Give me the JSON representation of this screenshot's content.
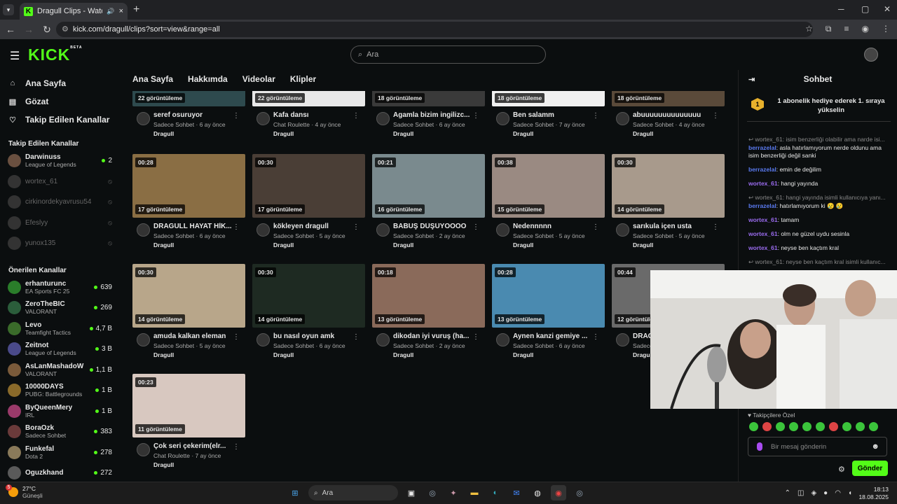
{
  "browser": {
    "tab_title": "Dragull Clips - Watch Live o",
    "url": "kick.com/dragull/clips?sort=view&range=all",
    "new_tab": "+",
    "tab_icon_letter": "K"
  },
  "header": {
    "logo": "KICK",
    "beta": "BETA",
    "search_placeholder": "Ara"
  },
  "sidebar": {
    "nav": [
      {
        "label": "Ana Sayfa",
        "icon": "home-icon"
      },
      {
        "label": "Gözat",
        "icon": "browse-icon"
      },
      {
        "label": "Takip Edilen Kanallar",
        "icon": "heart-icon"
      }
    ],
    "followed_title": "Takip Edilen Kanallar",
    "followed": [
      {
        "name": "Darwinuss",
        "game": "League of Legends",
        "count": "2",
        "live": true
      },
      {
        "name": "wortex_61",
        "live": false
      },
      {
        "name": "cirkinordekyavrusu54",
        "live": false
      },
      {
        "name": "Efeslyy",
        "live": false
      },
      {
        "name": "yunox135",
        "live": false
      }
    ],
    "recommended_title": "Önerilen Kanallar",
    "recommended": [
      {
        "name": "erhanturunc",
        "game": "EA Sports FC 25",
        "count": "639",
        "color": "#2a7d2a"
      },
      {
        "name": "ZeroTheBIC",
        "game": "VALORANT",
        "count": "269",
        "color": "#2b5d3b"
      },
      {
        "name": "Levo",
        "game": "Teamfight Tactics",
        "count": "4,7 B",
        "color": "#3a6b2a"
      },
      {
        "name": "Zeitnot",
        "game": "League of Legends",
        "count": "3 B",
        "color": "#4a4a8a"
      },
      {
        "name": "AsLanMashadoW",
        "game": "VALORANT",
        "count": "1,1 B",
        "color": "#7a5a3a"
      },
      {
        "name": "10000DAYS",
        "game": "PUBG: Battlegrounds",
        "count": "1 B",
        "color": "#8a6a2a"
      },
      {
        "name": "ByQueenMery",
        "game": "IRL",
        "count": "1 B",
        "color": "#9a3a6a"
      },
      {
        "name": "BoraOzk",
        "game": "Sadece Sohbet",
        "count": "383",
        "color": "#6a3a3a"
      },
      {
        "name": "Funkefal",
        "game": "Dota 2",
        "count": "278",
        "color": "#8a7a5a"
      },
      {
        "name": "Oguzkhand",
        "game": "",
        "count": "272",
        "color": "#5a5a5a"
      }
    ]
  },
  "main": {
    "tabs": [
      "Ana Sayfa",
      "Hakkımda",
      "Videolar",
      "Klipler"
    ],
    "clips": [
      {
        "title": "seref osuruyor",
        "category": "Sadece Sohbet",
        "age": "6 ay önce",
        "channel": "Dragull",
        "views": "22 görüntüleme",
        "duration": "",
        "bg": "#2e4a4e"
      },
      {
        "title": "Kafa dansı",
        "category": "Chat Roulette",
        "age": "4 ay önce",
        "channel": "Dragull",
        "views": "22 görüntüleme",
        "duration": "",
        "bg": "#e8e8e8"
      },
      {
        "title": "Agamla bizim ingilizc...",
        "category": "Sadece Sohbet",
        "age": "6 ay önce",
        "channel": "Dragull",
        "views": "18 görüntüleme",
        "duration": "",
        "bg": "#3a3a3a"
      },
      {
        "title": "Ben salamm",
        "category": "Sadece Sohbet",
        "age": "7 ay önce",
        "channel": "Dragull",
        "views": "18 görüntüleme",
        "duration": "",
        "bg": "#f0f0f0"
      },
      {
        "title": "abuuuuuuuuuuuuuu",
        "category": "Sadece Sohbet",
        "age": "4 ay önce",
        "channel": "Dragull",
        "views": "18 görüntüleme",
        "duration": "",
        "bg": "#5a4a3a"
      },
      {
        "title": "DRAGULL HAYAT HİK...",
        "category": "Sadece Sohbet",
        "age": "6 ay önce",
        "channel": "Dragull",
        "views": "17 görüntüleme",
        "duration": "00:28",
        "bg": "#8a6e44"
      },
      {
        "title": "kökleyen dragull",
        "category": "Sadece Sohbet",
        "age": "5 ay önce",
        "channel": "Dragull",
        "views": "17 görüntüleme",
        "duration": "00:30",
        "bg": "#4a3e36"
      },
      {
        "title": "BABUŞ DÜŞÜYOOOO",
        "category": "Sadece Sohbet",
        "age": "2 ay önce",
        "channel": "Dragull",
        "views": "16 görüntüleme",
        "duration": "00:21",
        "bg": "#7a8a8e"
      },
      {
        "title": "Nedennnnn",
        "category": "Sadece Sohbet",
        "age": "5 ay önce",
        "channel": "Dragull",
        "views": "15 görüntüleme",
        "duration": "00:38",
        "bg": "#9a8a82"
      },
      {
        "title": "sarıkula içen usta",
        "category": "Sadece Sohbet",
        "age": "5 ay önce",
        "channel": "Dragull",
        "views": "14 görüntüleme",
        "duration": "00:30",
        "bg": "#a89a8c"
      },
      {
        "title": "amuda kalkan eleman",
        "category": "Sadece Sohbet",
        "age": "5 ay önce",
        "channel": "Dragull",
        "views": "14 görüntüleme",
        "duration": "00:30",
        "bg": "#b8a68a"
      },
      {
        "title": "bu nasıl oyun amk",
        "category": "Sadece Sohbet",
        "age": "6 ay önce",
        "channel": "Dragull",
        "views": "14 görüntüleme",
        "duration": "00:30",
        "bg": "#1e2a22"
      },
      {
        "title": "dikodan iyi vuruş (ha...",
        "category": "Sadece Sohbet",
        "age": "2 ay önce",
        "channel": "Dragull",
        "views": "13 görüntüleme",
        "duration": "00:18",
        "bg": "#8a6a5a"
      },
      {
        "title": "Aynen kanzi gemiye ...",
        "category": "Sadece Sohbet",
        "age": "6 ay önce",
        "channel": "Dragull",
        "views": "13 görüntüleme",
        "duration": "00:28",
        "bg": "#4a8ab0"
      },
      {
        "title": "DRAG",
        "category": "Sadece Sohbet",
        "age": "",
        "channel": "Dragull",
        "views": "12 görüntüleme",
        "duration": "00:44",
        "bg": "#6a6a6a"
      },
      {
        "title": "Çok seri çekerim(elr...",
        "category": "Chat Roulette",
        "age": "7 ay önce",
        "channel": "Dragull",
        "views": "11 görüntüleme",
        "duration": "00:23",
        "bg": "#d8c8c0"
      }
    ]
  },
  "chat": {
    "title": "Sohbet",
    "pinned_badge": "1",
    "pinned": "1 abonelik hediye ederek 1. sıraya yükselin",
    "messages": [
      {
        "reply": "wortex_61: isim benzerliği olabilir ama narde isi..."
      },
      {
        "user": "berrazelal",
        "text": "asla hatırlamıyorum nerde oldunu ama isim benzerliği değil sanki",
        "color": "b"
      },
      {
        "user": "berrazelal",
        "text": "emin de değilim",
        "color": "b"
      },
      {
        "user": "wortex_61",
        "text": "hangi yayında",
        "color": "p"
      },
      {
        "reply": "wortex_61: hangi yayında isimli kullanıcıya yanı..."
      },
      {
        "user": "berrazelal",
        "text": "hatırlamıyorum ki 😢 😢",
        "color": "b"
      },
      {
        "user": "wortex_61",
        "text": "tamam",
        "color": "p"
      },
      {
        "user": "wortex_61",
        "text": "olm ne güzel uydu sesinla",
        "color": "p"
      },
      {
        "user": "wortex_61",
        "text": "neyse ben kaçtım kral",
        "color": "p"
      },
      {
        "reply": "wortex_61: neyse ben kaçtım kral isimli kullanıc..."
      }
    ],
    "followers_special": "Takipçilere Özel",
    "message_placeholder": "Bir mesaj gönderin",
    "send": "Gönder"
  },
  "taskbar": {
    "badge": "5",
    "temp": "27°C",
    "weather": "Güneşli",
    "search": "Ara",
    "time": "18:13",
    "date": "18.08.2025"
  }
}
